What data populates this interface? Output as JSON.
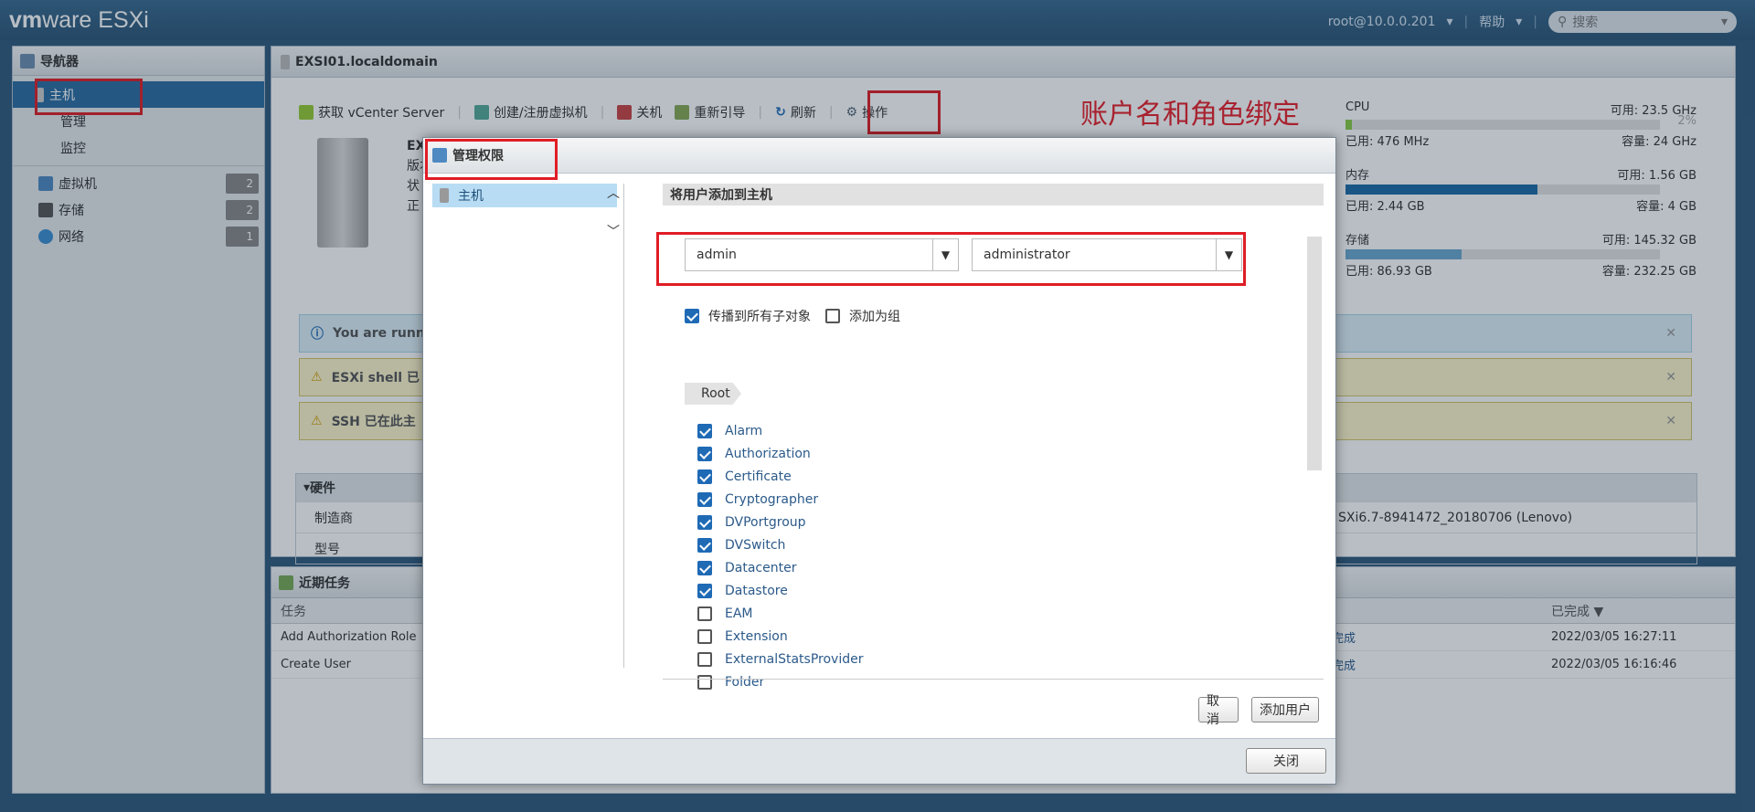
{
  "topbar": {
    "logo_bold": "vm",
    "logo_rest": "ware",
    "product": "ESXi",
    "user": "root@10.0.0.201",
    "help": "帮助",
    "search_placeholder": "搜索"
  },
  "navigator": {
    "title": "导航器",
    "host": "主机",
    "manage": "管理",
    "monitor": "监控",
    "groups": [
      {
        "label": "虚拟机",
        "count": "2"
      },
      {
        "label": "存储",
        "count": "2"
      },
      {
        "label": "网络",
        "count": "1"
      }
    ]
  },
  "main": {
    "title": "EXSI01.localdomain",
    "toolbar": [
      "获取 vCenter Server",
      "创建/注册虚拟机",
      "关机",
      "重新引导",
      "刷新",
      "操作"
    ],
    "annotation": "账户名和角色绑定",
    "stats": [
      {
        "name": "CPU",
        "free": "可用: 23.5 GHz",
        "pct": "2%",
        "used": "已用: 476 MHz",
        "cap": "容量: 24 GHz",
        "fill": 0.02
      },
      {
        "name": "内存",
        "free": "可用: 1.56 GB",
        "pct": "61%",
        "used": "已用: 2.44 GB",
        "cap": "容量: 4 GB",
        "fill": 0.61
      },
      {
        "name": "存储",
        "free": "可用: 145.32 GB",
        "pct": "37%",
        "used": "已用: 86.93 GB",
        "cap": "容量: 232.25 GB",
        "fill": 0.37
      }
    ],
    "alerts": [
      "You are runn",
      "ESXi shell 已",
      "SSH 已在此主"
    ],
    "hardware": {
      "title": "硬件",
      "rows": [
        {
          "label": "制造商",
          "value": "SXi6.7-8941472_20180706 (Lenovo)"
        },
        {
          "label": "型号",
          "value": ""
        }
      ]
    }
  },
  "host_partial": {
    "l1": "EX",
    "l2": "版本",
    "l3": "状",
    "l4": "正"
  },
  "tasks": {
    "title": "近期任务",
    "cols": [
      "任务",
      "已完成 ▼"
    ],
    "rows": [
      {
        "task": "Add Authorization Role",
        "status": "完成",
        "time": "2022/03/05 16:27:11"
      },
      {
        "task": "Create User",
        "status": "完成",
        "time": "2022/03/05 16:16:46"
      }
    ]
  },
  "modal": {
    "title": "管理权限",
    "left_item": "主机",
    "section": "将用户添加到主机",
    "user": "admin",
    "role": "administrator",
    "propagate": "传播到所有子对象",
    "add_group": "添加为组",
    "root": "Root",
    "privs": [
      {
        "name": "Alarm",
        "on": true
      },
      {
        "name": "Authorization",
        "on": true
      },
      {
        "name": "Certificate",
        "on": true
      },
      {
        "name": "Cryptographer",
        "on": true
      },
      {
        "name": "DVPortgroup",
        "on": true
      },
      {
        "name": "DVSwitch",
        "on": true
      },
      {
        "name": "Datacenter",
        "on": true
      },
      {
        "name": "Datastore",
        "on": true
      },
      {
        "name": "EAM",
        "on": false
      },
      {
        "name": "Extension",
        "on": false
      },
      {
        "name": "ExternalStatsProvider",
        "on": false
      },
      {
        "name": "Folder",
        "on": false
      }
    ],
    "cancel": "取消",
    "add_user": "添加用户",
    "close": "关闭"
  },
  "colors": {
    "accent": "#2b6ea3",
    "annotation": "#e8202a"
  }
}
